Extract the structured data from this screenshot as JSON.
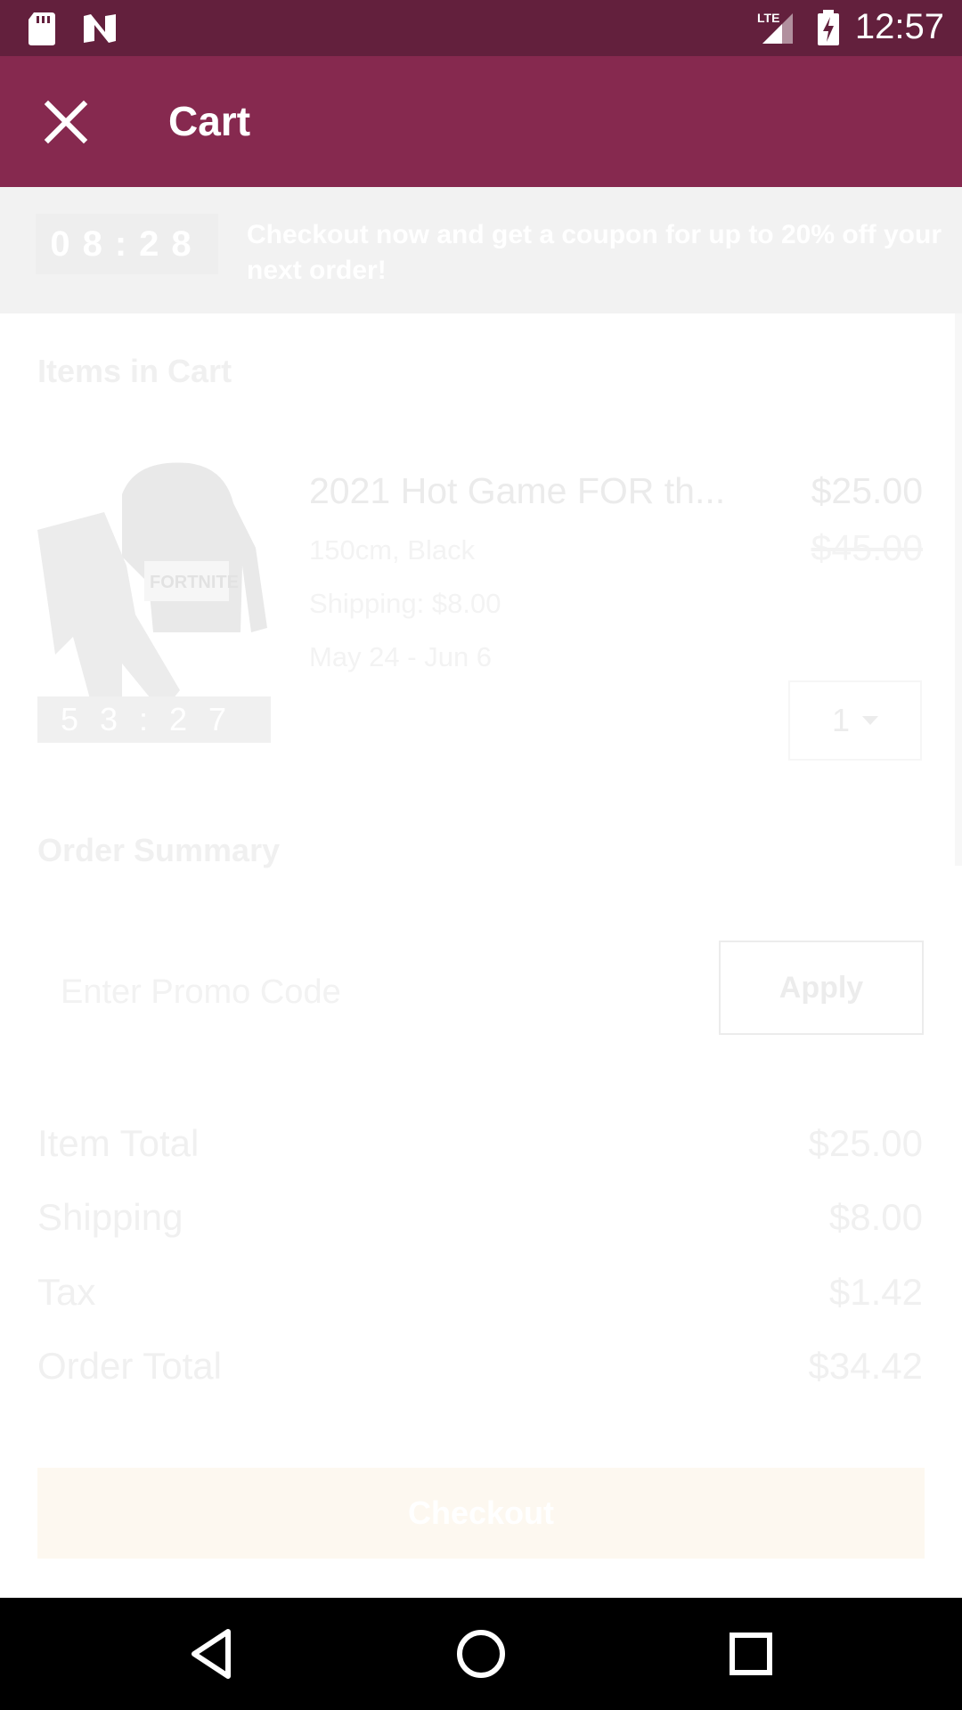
{
  "status_bar": {
    "time": "12:57",
    "network": "LTE",
    "icons": [
      "sd-card-icon",
      "n-notification-icon",
      "lte-signal-icon",
      "battery-charging-icon"
    ]
  },
  "app_bar": {
    "title": "Cart",
    "close_icon": "close-icon"
  },
  "promo_banner": {
    "timer": "08:28",
    "text": "Checkout now and get a coupon for up to 20% off your next order!"
  },
  "items_section": {
    "title": "Items in Cart",
    "items": [
      {
        "timer": "53:27",
        "name": "2021 Hot Game FOR th...",
        "price": "$25.00",
        "original_price": "$45.00",
        "variant": "150cm, Black",
        "shipping": "Shipping: $8.00",
        "dates": "May 24 - Jun 6",
        "quantity": "1"
      }
    ]
  },
  "order_summary": {
    "title": "Order Summary",
    "promo_placeholder": "Enter Promo Code",
    "apply_label": "Apply",
    "rows": [
      {
        "label": "Item Total",
        "value": "$25.00"
      },
      {
        "label": "Shipping",
        "value": "$8.00"
      },
      {
        "label": "Tax",
        "value": "$1.42"
      },
      {
        "label": "Order Total",
        "value": "$34.42"
      }
    ],
    "checkout_label": "Checkout"
  },
  "colors": {
    "status_bar": "#63203d",
    "app_bar": "#86294f"
  }
}
